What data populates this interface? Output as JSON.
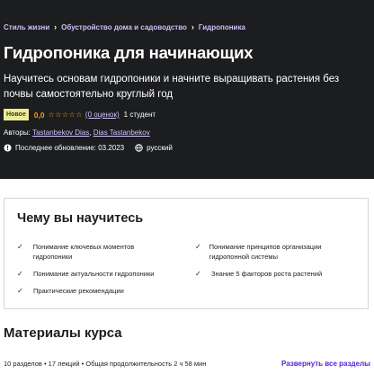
{
  "breadcrumb": [
    "Стиль жизни",
    "Обустройство дома и садоводство",
    "Гидропоника"
  ],
  "course": {
    "title": "Гидропоника для начинающих",
    "subtitle": "Научитесь основам гидропоники и начните выращивать растения без почвы самостоятельно круглый год",
    "badge": "Новое",
    "rating": "0,0",
    "stars": "☆☆☆☆☆",
    "reviews": "(0 оценок)",
    "students": "1 студент",
    "authors_label": "Авторы:",
    "authors": [
      "Tastanbekov Dias",
      "Dias Tastanbekov"
    ],
    "last_updated": "Последнее обновление: 03.2023",
    "language": "русский"
  },
  "learn": {
    "title": "Чему вы научитесь",
    "items": [
      "Понимание ключевых моментов гидропоники",
      "Понимание принципов организации гидропонной системы",
      "Понимание актуальности гидропоники",
      "Знание 5 факторов роста растений",
      "Практические рекомендации"
    ]
  },
  "materials": {
    "title": "Материалы курса",
    "summary": "10 разделов • 17 лекций • Общая продолжительность 2 ч 58 мин",
    "expand_all": "Развернуть все разделы"
  },
  "colors": {
    "hero_bg": "#1c1d1f",
    "link_purple": "#cec0fc",
    "rating_orange": "#f69c08",
    "badge_bg": "#eceb98",
    "accent": "#5624d0"
  },
  "icons": {
    "check": "check-icon",
    "alert": "alert-icon",
    "globe": "globe-icon"
  }
}
